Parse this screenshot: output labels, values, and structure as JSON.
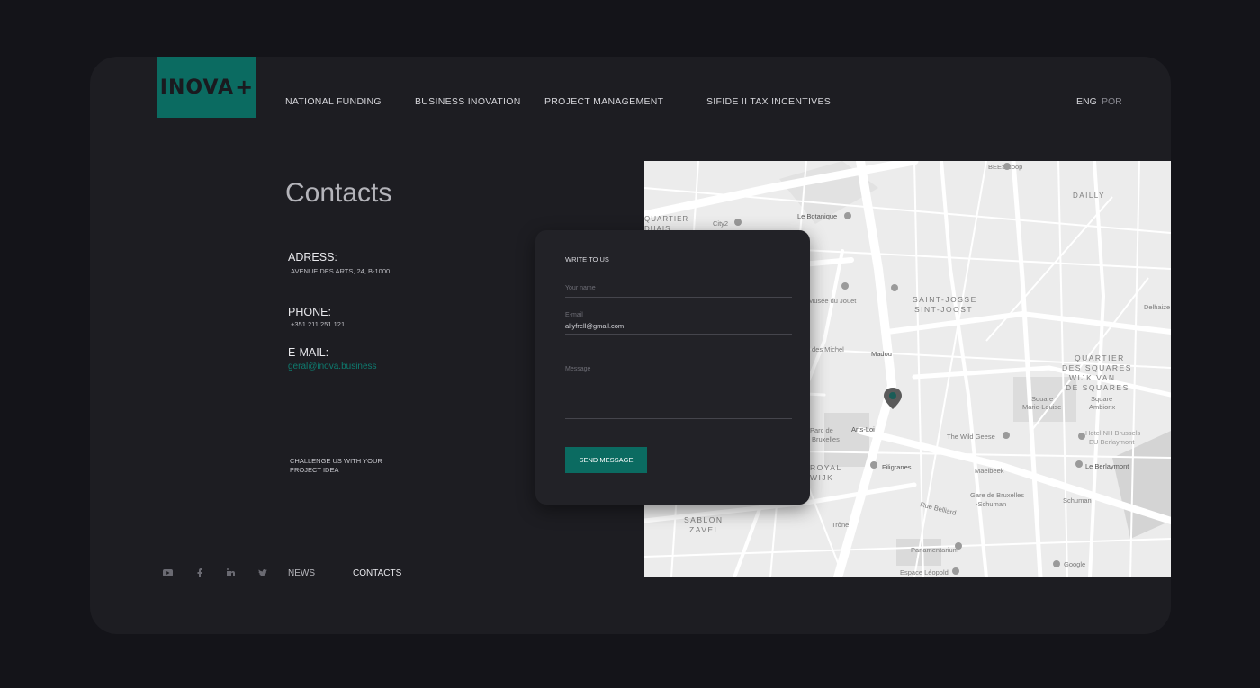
{
  "brand": {
    "name": "INOVA",
    "mark": "+"
  },
  "nav": [
    {
      "label": "NATIONAL FUNDING"
    },
    {
      "label": "BUSINESS INOVATION"
    },
    {
      "label": "PROJECT MANAGEMENT"
    },
    {
      "label": "SIFIDE II TAX INCENTIVES"
    }
  ],
  "lang": {
    "eng": "ENG",
    "por": "POR"
  },
  "page_title": "Contacts",
  "address": {
    "label": "ADRESS:",
    "value": "AVENUE DES ARTS, 24, B-1000"
  },
  "phone": {
    "label": "PHONE:",
    "value": "+351 211 251 121"
  },
  "email": {
    "label": "E-MAIL:",
    "value": "geral@inova.business"
  },
  "challenge": "CHALLENGE US WITH YOUR PROJECT IDEA",
  "footer": {
    "icons": [
      "youtube-icon",
      "facebook-icon",
      "linkedin-icon",
      "twitter-icon"
    ],
    "news": "NEWS",
    "contacts": "CONTACTS"
  },
  "form": {
    "title": "WRITE TO US",
    "name_placeholder": "Your name",
    "email_label": "E-mail",
    "email_value": "allyfrell@gmail.com",
    "message_placeholder": "Message",
    "send_label": "SEND MESSAGE"
  },
  "map": {
    "labels": [
      "BEES coop",
      "DAILLY",
      "QUARTIER",
      "DUAIS",
      "City2",
      "Le Botanique",
      "SAINT-JOSSE",
      "SINT-JOOST",
      "Musée du Jouet",
      "Delhaize",
      "Madou",
      "QUARTIER",
      "DES SQUARES",
      "WIJK VAN",
      "DE SQUARES",
      "Square",
      "Marie-Louise",
      "Square",
      "Ambiorix",
      "des Michel",
      "Arts-Loi",
      "Parc de",
      "Bruxelles",
      "The Wild Geese",
      "Hotel NH Brussels",
      "EU Berlaymont",
      "ROYAL",
      "WIJK",
      "Filigranes",
      "Maelbeek",
      "Le Berlaymont",
      "Gare de Bruxelles",
      "-Schuman",
      "Schuman",
      "SABLON",
      "ZAVEL",
      "Trône",
      "Parlamentarium",
      "Espace Léopold",
      "Google",
      "Rue Belliard"
    ],
    "pin_color": "#1a5c57"
  }
}
